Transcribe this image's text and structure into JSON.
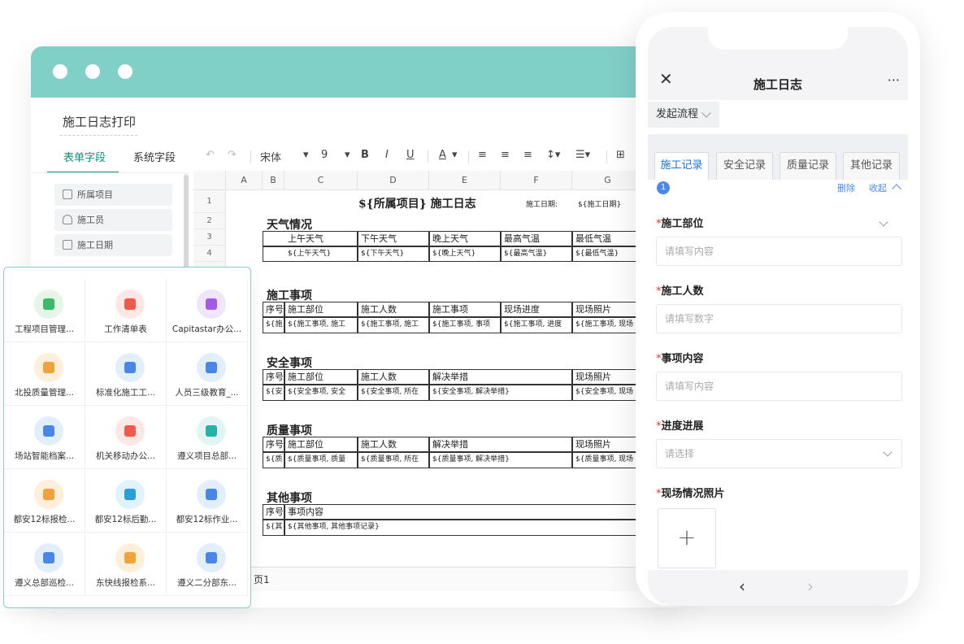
{
  "desktop": {
    "doc_title": "施工日志打印",
    "tabs": [
      "表单字段",
      "系统字段"
    ],
    "fields": [
      "所属项目",
      "施工员",
      "施工日期"
    ],
    "toolbar": {
      "font": "宋体",
      "size": "9",
      "bold": "B",
      "italic": "I",
      "underline": "U",
      "fontcolor": "A"
    },
    "columns": [
      "A",
      "B",
      "C",
      "D",
      "E",
      "F",
      "G"
    ],
    "rows": [
      "1",
      "2",
      "3",
      "4"
    ],
    "sheet": {
      "title": "${所属项目} 施工日志",
      "date_label": "施工日期:",
      "date_value": "${施工日期}",
      "weather_header": "天气情况",
      "weather_cols": [
        "上午天气",
        "下午天气",
        "晚上天气",
        "最高气温",
        "最低气温"
      ],
      "weather_vals": [
        "${上午天气}",
        "${下午天气}",
        "${晚上天气}",
        "${最高气温}",
        "${最低气温}"
      ],
      "construction_header": "施工事项",
      "construction_cols": [
        "序号",
        "施工部位",
        "施工人数",
        "施工事项",
        "现场进度",
        "现场照片"
      ],
      "construction_vals": [
        "${施",
        "${施工事项, 施工",
        "${施工事项, 施工",
        "${施工事项, 事项",
        "${施工事项, 进度",
        "${施工事项, 现场"
      ],
      "safety_header": "安全事项",
      "safety_cols": [
        "序号",
        "施工部位",
        "施工人数",
        "解决举措",
        "现场照片"
      ],
      "safety_vals": [
        "${安",
        "${安全事项, 安全",
        "${安全事项, 所在",
        "${安全事项, 解决举措}",
        "${安全事项, 现场"
      ],
      "quality_header": "质量事项",
      "quality_cols": [
        "序号",
        "施工部位",
        "施工人数",
        "解决举措",
        "现场照片"
      ],
      "quality_vals": [
        "${质",
        "${质量事项, 质量",
        "${质量事项, 所在",
        "${质量事项, 解决举措}",
        "${质量事项, 现场"
      ],
      "other_header": "其他事项",
      "other_cols": [
        "序号",
        "事项内容"
      ],
      "other_vals": [
        "${其",
        "${其他事项, 其他事项记录}"
      ],
      "page_tab": "页1"
    }
  },
  "apps": [
    {
      "label": "工程项目管理...",
      "color": "#e5f6e8",
      "inner": "#3bb86a"
    },
    {
      "label": "工作清单表",
      "color": "#fde8e6",
      "inner": "#ef5a4c"
    },
    {
      "label": "Capitastar办公...",
      "color": "#f0e6fb",
      "inner": "#a35ae6"
    },
    {
      "label": "北投质量管理...",
      "color": "#fdefd9",
      "inner": "#f0a23c"
    },
    {
      "label": "标准化施工工...",
      "color": "#e3eefc",
      "inner": "#4a86e8"
    },
    {
      "label": "人员三级教育_...",
      "color": "#e3eefc",
      "inner": "#4a86e8"
    },
    {
      "label": "场站智能档案...",
      "color": "#e3eefc",
      "inner": "#4a86e8"
    },
    {
      "label": "机关移动办公...",
      "color": "#fde8e6",
      "inner": "#ef5a4c"
    },
    {
      "label": "遵义项目总部...",
      "color": "#e2f5f4",
      "inner": "#2ab1a6"
    },
    {
      "label": "都安12标报检...",
      "color": "#fdefd9",
      "inner": "#f0a23c"
    },
    {
      "label": "都安12标后勤...",
      "color": "#e0f2fb",
      "inner": "#2aa0d8"
    },
    {
      "label": "都安12标作业...",
      "color": "#e3eefc",
      "inner": "#4a86e8"
    },
    {
      "label": "遵义总部巡检...",
      "color": "#e3eefc",
      "inner": "#4a86e8"
    },
    {
      "label": "东快线报检系...",
      "color": "#fdefd9",
      "inner": "#f0a23c"
    },
    {
      "label": "遵义二分部东...",
      "color": "#e3eefc",
      "inner": "#4a86e8"
    }
  ],
  "phone": {
    "close": "✕",
    "title": "施工日志",
    "more": "···",
    "flow": "发起流程",
    "tabs": [
      "施工记录",
      "安全记录",
      "质量记录",
      "其他记录"
    ],
    "badge": "1",
    "delete": "删除",
    "collapse": "收起",
    "fields": [
      {
        "label": "施工部位",
        "placeholder": "请填写内容"
      },
      {
        "label": "施工人数",
        "placeholder": "请填写数字"
      },
      {
        "label": "事项内容",
        "placeholder": "请填写内容"
      },
      {
        "label": "进度进展",
        "placeholder": "请选择"
      }
    ],
    "photo_label": "现场情况照片",
    "plus": "+",
    "prev": "‹",
    "next": "›",
    "accent": "#1a73e8"
  }
}
